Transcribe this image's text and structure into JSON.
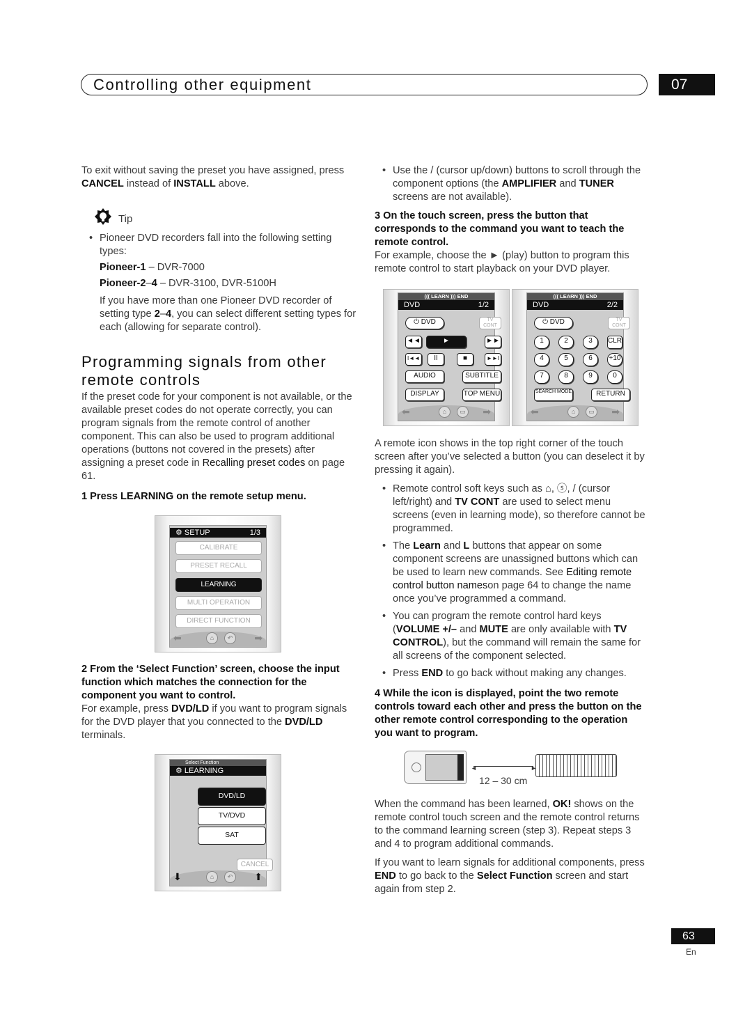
{
  "header": {
    "title": "Controlling other equipment",
    "chapter": "07"
  },
  "footer": {
    "page": "63",
    "lang": "En"
  },
  "left": {
    "p1": [
      {
        "t": "To exit without saving the preset you have assigned, press "
      },
      {
        "t": "CANCEL",
        "b": 1
      },
      {
        "t": " instead of "
      },
      {
        "t": "INSTALL",
        "b": 1
      },
      {
        "t": " above."
      }
    ],
    "tip_label": "Tip",
    "tip_bullet": [
      {
        "t": "Pioneer DVD recorders fall into the following setting types:"
      }
    ],
    "tip_p1": [
      {
        "t": "Pioneer-1",
        "b": 1
      },
      {
        "t": " – DVR-7000"
      }
    ],
    "tip_p2": [
      {
        "t": "Pioneer-2",
        "b": 1
      },
      {
        "t": "–"
      },
      {
        "t": "4",
        "b": 1
      },
      {
        "t": " – DVR-3100, DVR-5100H"
      }
    ],
    "tip_p3": [
      {
        "t": "If you have more than one Pioneer DVD recorder of setting type "
      },
      {
        "t": "2",
        "b": 1
      },
      {
        "t": "–"
      },
      {
        "t": "4",
        "b": 1
      },
      {
        "t": ", you can select different setting types for each (allowing for separate control)."
      }
    ],
    "heading": "Programming signals from other remote controls",
    "p2": [
      {
        "t": "If the preset code for your component is not available, or the available preset codes do not operate correctly, you can program signals from the remote control of another component. This can also be used to program additional operations (buttons not covered in the presets) after assigning a preset code in "
      },
      {
        "t": "Recalling preset codes",
        "l": 1
      },
      {
        "t": " on page 61."
      }
    ],
    "step1": "1   Press LEARNING on the remote setup menu.",
    "setup_screen": {
      "title": "SETUP",
      "page": "1/3",
      "items": [
        "CALIBRATE",
        "PRESET RECALL",
        "LEARNING",
        "MULTI OPERATION",
        "DIRECT FUNCTION"
      ]
    },
    "step2": "2   From the ‘Select Function’ screen, choose the input function which matches the connection for the component you want to control.",
    "p3": [
      {
        "t": "For example, press "
      },
      {
        "t": "DVD/LD",
        "b": 1
      },
      {
        "t": " if you want to program signals for the DVD player that you connected to the "
      },
      {
        "t": "DVD/LD",
        "b": 1
      },
      {
        "t": " terminals."
      }
    ],
    "select_screen": {
      "caption": "Select Function",
      "title": "LEARNING",
      "items": [
        "DVD/LD",
        "TV/DVD",
        "SAT"
      ],
      "cancel": "CANCEL"
    }
  },
  "right": {
    "b1": [
      {
        "t": "Use the  /      (cursor up/down) buttons to scroll through the component options (the "
      },
      {
        "t": "AMPLIFIER",
        "b": 1
      },
      {
        "t": " and "
      },
      {
        "t": "TUNER",
        "b": 1
      },
      {
        "t": " screens are not available)."
      }
    ],
    "step3": "3   On the touch screen, press the button that corresponds to the command you want to teach the remote control.",
    "p1": [
      {
        "t": "For example, choose the ► (play) button to program this remote control to start playback on your DVD player."
      }
    ],
    "screen1": {
      "learn": "((( LEARN ))) END",
      "title": "DVD",
      "page": "1/2",
      "power": "⏻ DVD",
      "tvcont": "TV CONT",
      "row1": [
        "◄◄",
        "►",
        "►►"
      ],
      "row2": [
        "I◄◄",
        "II",
        "■",
        "►►I"
      ],
      "row3": [
        "AUDIO",
        "SUBTITLE"
      ],
      "row4": [
        "DISPLAY",
        "TOP MENU"
      ]
    },
    "screen2": {
      "learn": "((( LEARN ))) END",
      "title": "DVD",
      "page": "2/2",
      "power": "⏻ DVD",
      "tvcont": "TV CONT",
      "keys": [
        "1",
        "2",
        "3",
        "CLR",
        "4",
        "5",
        "6",
        "+10",
        "7",
        "8",
        "9",
        "0"
      ],
      "row4": [
        "SEARCH MODE",
        "RETURN"
      ]
    },
    "p2": [
      {
        "t": "A remote icon shows in the top right corner of the touch screen after you’ve selected a button (you can deselect it by pressing it again)."
      }
    ],
    "b2": [
      {
        "t": "Remote control soft keys such as ⌂, ⓢ,  / (cursor left/right) and "
      },
      {
        "t": "TV CONT",
        "b": 1
      },
      {
        "t": " are used to select menu screens (even in learning mode), so therefore cannot be programmed."
      }
    ],
    "b3": [
      {
        "t": "The "
      },
      {
        "t": "Learn",
        "b": 1
      },
      {
        "t": "    and "
      },
      {
        "t": "L",
        "b": 1
      },
      {
        "t": "    buttons that appear on some component screens are unassigned buttons which can be used to learn new commands. See "
      },
      {
        "t": "Editing remote control button names",
        "l": 1
      },
      {
        "t": "on page 64 to change the name once you’ve programmed a command."
      }
    ],
    "b4": [
      {
        "t": "You can program the remote control hard keys ("
      },
      {
        "t": "VOLUME +/–",
        "b": 1
      },
      {
        "t": " and "
      },
      {
        "t": "MUTE",
        "b": 1
      },
      {
        "t": " are only available with "
      },
      {
        "t": "TV CONTROL",
        "b": 1
      },
      {
        "t": "), but the command will remain the same for all screens of the component selected."
      }
    ],
    "b5": [
      {
        "t": "Press "
      },
      {
        "t": "END",
        "b": 1
      },
      {
        "t": " to go back without making any changes."
      }
    ],
    "step4": "4   While the icon is displayed, point the two remote controls toward each other and press the button on the other remote control corresponding to the operation you want to program.",
    "distance": "12 – 30 cm",
    "p3": [
      {
        "t": "When the command has been learned, "
      },
      {
        "t": "OK!",
        "b": 1
      },
      {
        "t": " shows on the remote control touch screen and the remote control returns to the command learning screen (step 3). Repeat steps 3 and 4 to program additional commands."
      }
    ],
    "p4": [
      {
        "t": "If you want to learn signals for additional components, press "
      },
      {
        "t": "END",
        "b": 1
      },
      {
        "t": " to go back to the "
      },
      {
        "t": "Select Function",
        "b": 1
      },
      {
        "t": " screen and start again from step 2."
      }
    ]
  }
}
